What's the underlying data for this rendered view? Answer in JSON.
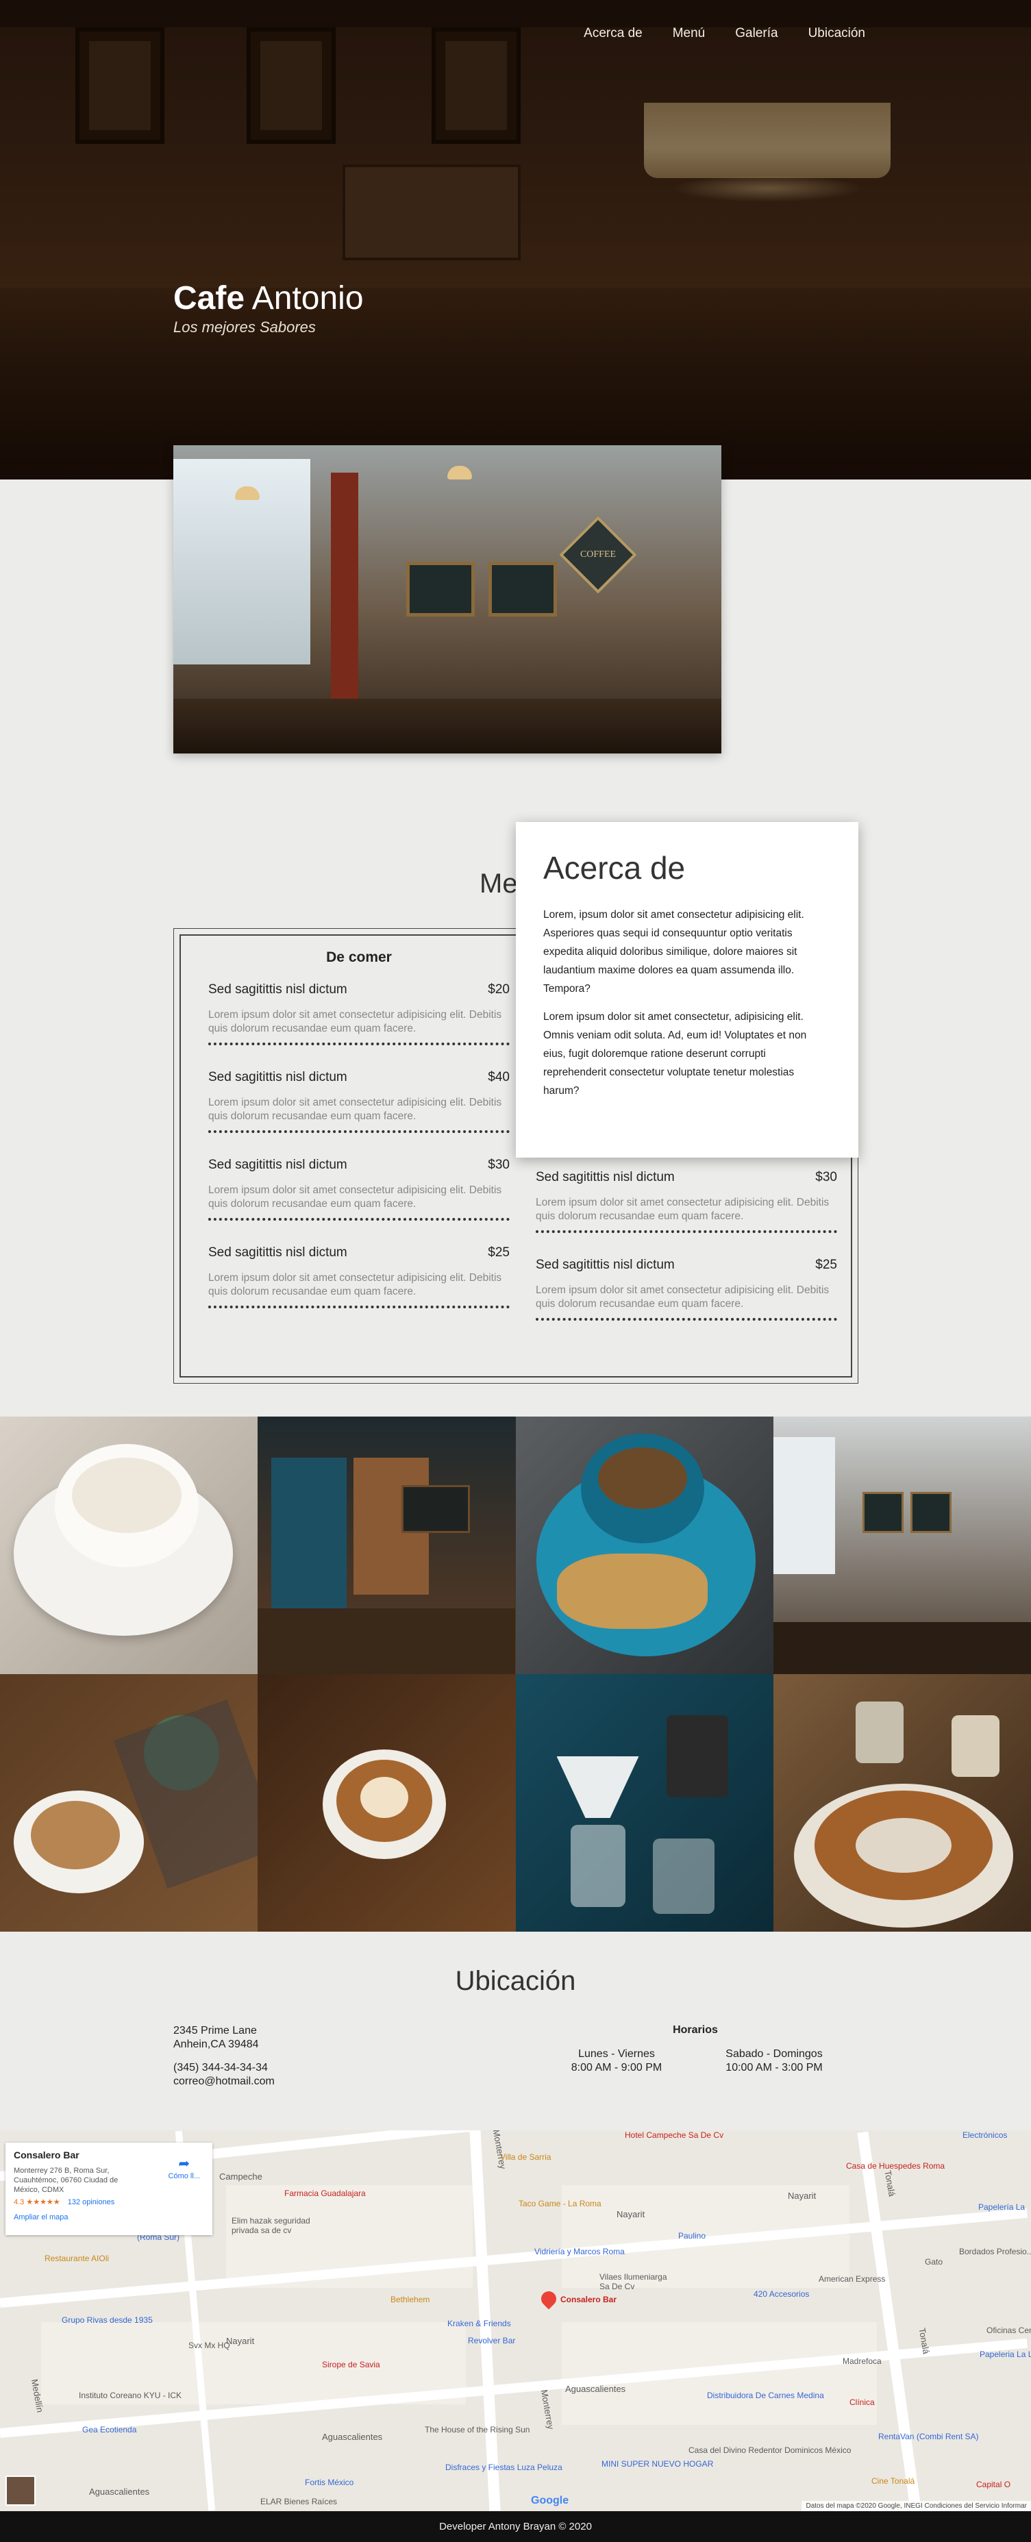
{
  "nav": {
    "items": [
      "Acerca de",
      "Menú",
      "Galería",
      "Ubicación"
    ]
  },
  "brand": {
    "name_bold": "Cafe",
    "name_light": "Antonio",
    "tagline": "Los mejores Sabores"
  },
  "feature": {
    "sign_text": "COFFEE"
  },
  "about": {
    "title": "Acerca de",
    "paragraphs": [
      "Lorem, ipsum dolor sit amet consectetur adipisicing elit. Asperiores quas sequi id consequuntur optio veritatis expedita aliquid doloribus similique, dolore maiores sit laudantium maxime dolores ea quam assumenda illo. Tempora?",
      "Lorem ipsum dolor sit amet consectetur, adipisicing elit. Omnis veniam odit soluta. Ad, eum id! Voluptates et non eius, fugit doloremque ratione deserunt corrupti reprehenderit consectetur voluptate tenetur molestias harum?"
    ]
  },
  "menu": {
    "title": "Menú",
    "left": {
      "heading": "De comer",
      "items": [
        {
          "name": "Sed sagitittis nisl dictum",
          "price": "$20",
          "desc": "Lorem ipsum dolor sit amet consectetur adipisicing elit. Debitis quis dolorum recusandae eum quam facere."
        },
        {
          "name": "Sed sagitittis nisl dictum",
          "price": "$40",
          "desc": "Lorem ipsum dolor sit amet consectetur adipisicing elit. Debitis quis dolorum recusandae eum quam facere."
        },
        {
          "name": "Sed sagitittis nisl dictum",
          "price": "$30",
          "desc": "Lorem ipsum dolor sit amet consectetur adipisicing elit. Debitis quis dolorum recusandae eum quam facere."
        },
        {
          "name": "Sed sagitittis nisl dictum",
          "price": "$25",
          "desc": "Lorem ipsum dolor sit amet consectetur adipisicing elit. Debitis quis dolorum recusandae eum quam facere."
        }
      ]
    },
    "right": {
      "items": [
        {
          "name": "Sed sagitittis nisl dictum",
          "price": "$30",
          "desc": "Lorem ipsum dolor sit amet consectetur adipisicing elit. Debitis quis dolorum recusandae eum quam facere."
        },
        {
          "name": "Sed sagitittis nisl dictum",
          "price": "$25",
          "desc": "Lorem ipsum dolor sit amet consectetur adipisicing elit. Debitis quis dolorum recusandae eum quam facere."
        }
      ]
    }
  },
  "gallery": {
    "tiles": [
      "cappuccino-cup",
      "cafe-interior-shelves",
      "blue-cup-biscotti",
      "cafe-counter",
      "latte-art-succulent",
      "latte-on-wood",
      "pour-over-coffee",
      "pastry-plate"
    ]
  },
  "location": {
    "title": "Ubicación",
    "address_line1": "2345 Prime Lane",
    "address_line2": "Anhein,CA 39484",
    "phone": "(345) 344-34-34-34",
    "email": "correo@hotmail.com",
    "hours_title": "Horarios",
    "weekdays_label": "Lunes - Viernes",
    "weekdays_hours": "8:00 AM - 9:00 PM",
    "weekend_label": "Sabado - Domingos",
    "weekend_hours": "10:00 AM - 3:00 PM"
  },
  "map": {
    "place_name": "Consalero Bar",
    "place_address": "Monterrey 276 B, Roma Sur, Cuauhtémoc, 06760 Ciudad de México, CDMX",
    "rating": "4.3 ★★★★★",
    "reviews": "132 opiniones",
    "enlarge": "Ampliar el mapa",
    "directions": "Cómo ll...",
    "pin_label": "Consalero Bar",
    "attribution": "Datos del mapa ©2020 Google, INEGI   Condiciones del Servicio   Informar",
    "google": "Google",
    "streets": [
      "Campeche",
      "Nayarit",
      "Nayarit",
      "Nayarit",
      "Aguascalientes",
      "Aguascalientes",
      "Aguascalientes",
      "Monterrey",
      "Monterrey",
      "Medellín",
      "Tonalá",
      "Tonalá"
    ],
    "pois": [
      "Villa de Sarria",
      "Hotel Campeche Sa De Cv",
      "Farmacia Guadalajara",
      "Taco Game - La Roma",
      "Vidriería y Marcos Roma",
      "Restaurante AIOli",
      "Bethlehem",
      "Kraken & Friends",
      "Revolver Bar",
      "Sirope de Savia",
      "Grupo Rivas desde 1935",
      "Svx Mx HQ",
      "Instituto Coreano KYU - ICK",
      "Gea Ecotienda",
      "The House of the Rising Sun",
      "Disfraces y Fiestas Luza Peluza",
      "Fortis México",
      "ELAR Bienes Raíces",
      "MINI SUPER NUEVO HOGAR",
      "Casa del Divino Redentor Dominicos México",
      "Distribuidora De Carnes Medina",
      "420 Accesorios",
      "American Express",
      "Madrefoca",
      "Clínica",
      "RentaVan (Combi Rent SA)",
      "Cine Tonalá",
      "Capital O",
      "Papeleria La Luz",
      "Oficinas Centrales",
      "Bordados Profesio...",
      "Papelería La",
      "Gato",
      "Casa de Huespedes Roma",
      "Elim hazak seguridad privada sa de cv",
      "Correo Campeche (Roma Sur)",
      "Paulino",
      "Vilaes Ilumeniarga Sa De Cv",
      "Electrónicos"
    ]
  },
  "footer": {
    "text": "Developer Antony Brayan © 2020"
  },
  "colors": {
    "hero_dark": "#2a1a0f",
    "page_bg": "#ececea",
    "footer_bg": "#111111",
    "map_link": "#1a73e8",
    "map_pin": "#ea4335"
  }
}
